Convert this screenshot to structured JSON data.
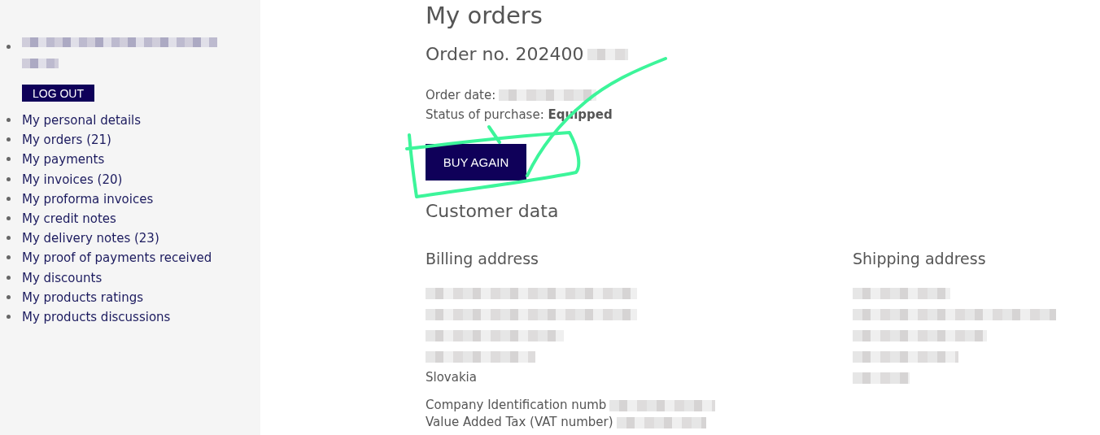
{
  "sidebar": {
    "user": {
      "lines": [
        {
          "kind": "redacted"
        },
        {
          "kind": "redacted"
        }
      ]
    },
    "logout_button": "LOG OUT",
    "items": [
      {
        "label": "My personal details"
      },
      {
        "label": "My orders (21)"
      },
      {
        "label": "My payments"
      },
      {
        "label": "My invoices (20)"
      },
      {
        "label": "My proforma invoices"
      },
      {
        "label": "My credit notes"
      },
      {
        "label": "My delivery notes (23)"
      },
      {
        "label": "My proof of payments received"
      },
      {
        "label": "My discounts"
      },
      {
        "label": "My products ratings"
      },
      {
        "label": "My products discussions"
      }
    ]
  },
  "main": {
    "title": "My orders",
    "order_heading": "Order no. 202400",
    "order_date_label": "Order date:",
    "status_label": "Status of purchase:",
    "status_value": "Equipped",
    "buy_again_button": "BUY AGAIN",
    "customer_heading": "Customer data",
    "billing": {
      "heading": "Billing address",
      "lines": [
        {
          "kind": "redacted"
        },
        {
          "kind": "redacted"
        },
        {
          "kind": "redacted"
        },
        {
          "kind": "redacted"
        },
        {
          "kind": "text",
          "text": "Slovakia"
        }
      ]
    },
    "shipping": {
      "heading": "Shipping address",
      "lines": [
        {
          "kind": "redacted"
        },
        {
          "kind": "redacted"
        },
        {
          "kind": "redacted"
        },
        {
          "kind": "redacted"
        },
        {
          "kind": "redacted"
        }
      ]
    },
    "company_fields": [
      {
        "label": "Company Identification numb"
      },
      {
        "label": "Value Added Tax (VAT number)"
      }
    ]
  }
}
